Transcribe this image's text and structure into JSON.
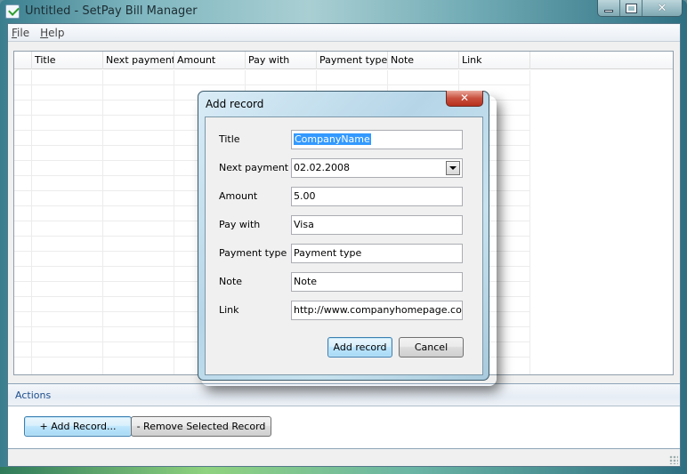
{
  "window": {
    "title": "Untitled - SetPay Bill Manager",
    "buttons": {
      "minimize": "minimize",
      "maximize": "maximize",
      "close": "✕"
    }
  },
  "menu": [
    {
      "label": "File",
      "accel": "F",
      "rest": "ile"
    },
    {
      "label": "Help",
      "accel": "H",
      "rest": "elp"
    }
  ],
  "grid": {
    "columns": [
      "",
      "Title",
      "Next payment",
      "Amount",
      "Pay with",
      "Payment type",
      "Note",
      "Link",
      ""
    ],
    "rows": []
  },
  "actions": {
    "header": "Actions",
    "add_button": "+ Add Record...",
    "remove_button": "- Remove Selected Record"
  },
  "dialog": {
    "title": "Add record",
    "close": "✕",
    "fields": [
      {
        "label": "Title",
        "value": "CompanyName",
        "selected": true
      },
      {
        "label": "Next payment",
        "value": "02.02.2008",
        "type": "date-dropdown"
      },
      {
        "label": "Amount",
        "value": "5.00"
      },
      {
        "label": "Pay with",
        "value": "Visa"
      },
      {
        "label": "Payment type",
        "value": "Payment type"
      },
      {
        "label": "Note",
        "value": "Note"
      },
      {
        "label": "Link",
        "value": "http://www.companyhomepage.com"
      }
    ],
    "ok_button": "Add record",
    "cancel_button": "Cancel"
  }
}
